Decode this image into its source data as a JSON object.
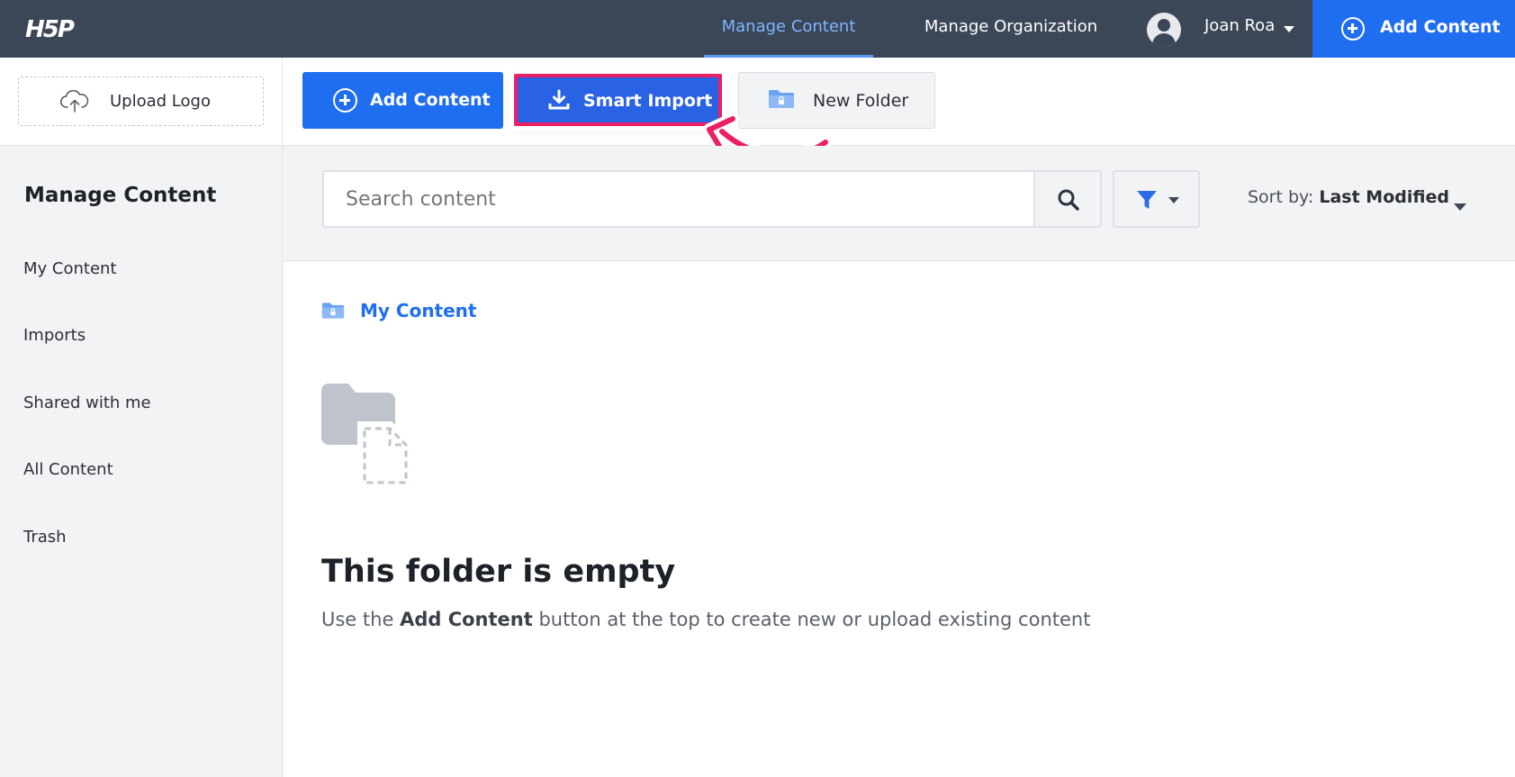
{
  "topbar": {
    "logo": "H5P",
    "tabs": [
      {
        "label": "Manage Content",
        "active": true
      },
      {
        "label": "Manage Organization",
        "active": false
      }
    ],
    "user_name": "Joan Roa",
    "add_content_label": "Add Content"
  },
  "toolbar": {
    "upload_logo_label": "Upload Logo",
    "add_content_label": "Add Content",
    "smart_import_label": "Smart Import",
    "new_folder_label": "New Folder"
  },
  "sidebar": {
    "title": "Manage Content",
    "items": [
      {
        "label": "My Content"
      },
      {
        "label": "Imports"
      },
      {
        "label": "Shared with me"
      },
      {
        "label": "All Content"
      },
      {
        "label": "Trash"
      }
    ]
  },
  "search": {
    "placeholder": "Search content",
    "sort_prefix": "Sort by:",
    "sort_value": "Last Modified"
  },
  "main": {
    "breadcrumb": "My Content",
    "empty_title": "This folder is empty",
    "empty_desc_before": "Use the",
    "empty_desc_bold": "Add Content",
    "empty_desc_after": "button at the top to create new or upload existing content"
  },
  "colors": {
    "topbar_bg": "#3b4657",
    "primary": "#1f6ef0",
    "highlight_border": "#ec1f64",
    "active_tab": "#7fb5ff"
  },
  "icons": [
    "cloud-upload-icon",
    "plus-circle-icon",
    "download-icon",
    "folder-icon",
    "search-icon",
    "filter-icon",
    "user-icon",
    "caret-down-icon",
    "empty-folder-icon",
    "annotation-arrow-icon"
  ]
}
